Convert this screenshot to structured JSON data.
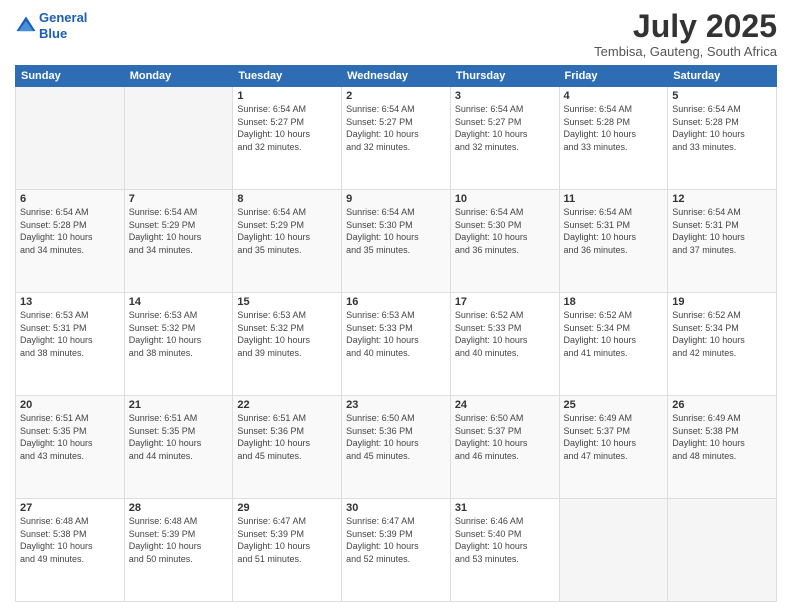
{
  "header": {
    "logo_line1": "General",
    "logo_line2": "Blue",
    "month_title": "July 2025",
    "subtitle": "Tembisa, Gauteng, South Africa"
  },
  "days_of_week": [
    "Sunday",
    "Monday",
    "Tuesday",
    "Wednesday",
    "Thursday",
    "Friday",
    "Saturday"
  ],
  "weeks": [
    [
      {
        "day": "",
        "info": ""
      },
      {
        "day": "",
        "info": ""
      },
      {
        "day": "1",
        "info": "Sunrise: 6:54 AM\nSunset: 5:27 PM\nDaylight: 10 hours\nand 32 minutes."
      },
      {
        "day": "2",
        "info": "Sunrise: 6:54 AM\nSunset: 5:27 PM\nDaylight: 10 hours\nand 32 minutes."
      },
      {
        "day": "3",
        "info": "Sunrise: 6:54 AM\nSunset: 5:27 PM\nDaylight: 10 hours\nand 32 minutes."
      },
      {
        "day": "4",
        "info": "Sunrise: 6:54 AM\nSunset: 5:28 PM\nDaylight: 10 hours\nand 33 minutes."
      },
      {
        "day": "5",
        "info": "Sunrise: 6:54 AM\nSunset: 5:28 PM\nDaylight: 10 hours\nand 33 minutes."
      }
    ],
    [
      {
        "day": "6",
        "info": "Sunrise: 6:54 AM\nSunset: 5:28 PM\nDaylight: 10 hours\nand 34 minutes."
      },
      {
        "day": "7",
        "info": "Sunrise: 6:54 AM\nSunset: 5:29 PM\nDaylight: 10 hours\nand 34 minutes."
      },
      {
        "day": "8",
        "info": "Sunrise: 6:54 AM\nSunset: 5:29 PM\nDaylight: 10 hours\nand 35 minutes."
      },
      {
        "day": "9",
        "info": "Sunrise: 6:54 AM\nSunset: 5:30 PM\nDaylight: 10 hours\nand 35 minutes."
      },
      {
        "day": "10",
        "info": "Sunrise: 6:54 AM\nSunset: 5:30 PM\nDaylight: 10 hours\nand 36 minutes."
      },
      {
        "day": "11",
        "info": "Sunrise: 6:54 AM\nSunset: 5:31 PM\nDaylight: 10 hours\nand 36 minutes."
      },
      {
        "day": "12",
        "info": "Sunrise: 6:54 AM\nSunset: 5:31 PM\nDaylight: 10 hours\nand 37 minutes."
      }
    ],
    [
      {
        "day": "13",
        "info": "Sunrise: 6:53 AM\nSunset: 5:31 PM\nDaylight: 10 hours\nand 38 minutes."
      },
      {
        "day": "14",
        "info": "Sunrise: 6:53 AM\nSunset: 5:32 PM\nDaylight: 10 hours\nand 38 minutes."
      },
      {
        "day": "15",
        "info": "Sunrise: 6:53 AM\nSunset: 5:32 PM\nDaylight: 10 hours\nand 39 minutes."
      },
      {
        "day": "16",
        "info": "Sunrise: 6:53 AM\nSunset: 5:33 PM\nDaylight: 10 hours\nand 40 minutes."
      },
      {
        "day": "17",
        "info": "Sunrise: 6:52 AM\nSunset: 5:33 PM\nDaylight: 10 hours\nand 40 minutes."
      },
      {
        "day": "18",
        "info": "Sunrise: 6:52 AM\nSunset: 5:34 PM\nDaylight: 10 hours\nand 41 minutes."
      },
      {
        "day": "19",
        "info": "Sunrise: 6:52 AM\nSunset: 5:34 PM\nDaylight: 10 hours\nand 42 minutes."
      }
    ],
    [
      {
        "day": "20",
        "info": "Sunrise: 6:51 AM\nSunset: 5:35 PM\nDaylight: 10 hours\nand 43 minutes."
      },
      {
        "day": "21",
        "info": "Sunrise: 6:51 AM\nSunset: 5:35 PM\nDaylight: 10 hours\nand 44 minutes."
      },
      {
        "day": "22",
        "info": "Sunrise: 6:51 AM\nSunset: 5:36 PM\nDaylight: 10 hours\nand 45 minutes."
      },
      {
        "day": "23",
        "info": "Sunrise: 6:50 AM\nSunset: 5:36 PM\nDaylight: 10 hours\nand 45 minutes."
      },
      {
        "day": "24",
        "info": "Sunrise: 6:50 AM\nSunset: 5:37 PM\nDaylight: 10 hours\nand 46 minutes."
      },
      {
        "day": "25",
        "info": "Sunrise: 6:49 AM\nSunset: 5:37 PM\nDaylight: 10 hours\nand 47 minutes."
      },
      {
        "day": "26",
        "info": "Sunrise: 6:49 AM\nSunset: 5:38 PM\nDaylight: 10 hours\nand 48 minutes."
      }
    ],
    [
      {
        "day": "27",
        "info": "Sunrise: 6:48 AM\nSunset: 5:38 PM\nDaylight: 10 hours\nand 49 minutes."
      },
      {
        "day": "28",
        "info": "Sunrise: 6:48 AM\nSunset: 5:39 PM\nDaylight: 10 hours\nand 50 minutes."
      },
      {
        "day": "29",
        "info": "Sunrise: 6:47 AM\nSunset: 5:39 PM\nDaylight: 10 hours\nand 51 minutes."
      },
      {
        "day": "30",
        "info": "Sunrise: 6:47 AM\nSunset: 5:39 PM\nDaylight: 10 hours\nand 52 minutes."
      },
      {
        "day": "31",
        "info": "Sunrise: 6:46 AM\nSunset: 5:40 PM\nDaylight: 10 hours\nand 53 minutes."
      },
      {
        "day": "",
        "info": ""
      },
      {
        "day": "",
        "info": ""
      }
    ]
  ]
}
